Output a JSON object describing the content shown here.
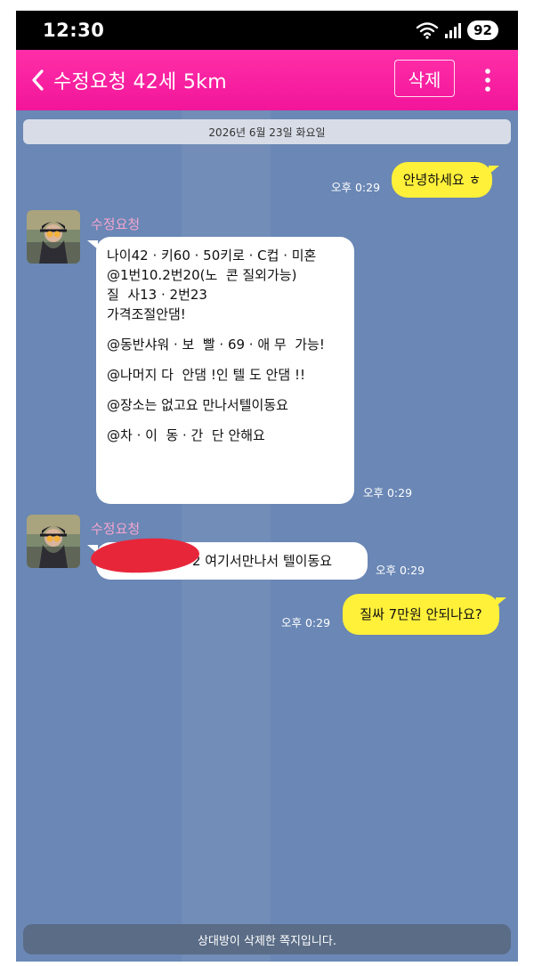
{
  "status_bar": {
    "time": "12:30",
    "battery": "92",
    "wifi_icon": "wifi-icon",
    "signal_icon": "signal-icon"
  },
  "header": {
    "title": "수정요청 42세 5km",
    "delete_label": "삭제",
    "back_icon": "chevron-left-icon",
    "more_icon": "more-vertical-icon"
  },
  "date": "2026년 6월 23일 화요일",
  "messages": [
    {
      "from": "me",
      "text": "안녕하세요 ㅎ",
      "time": "오후 0:29"
    },
    {
      "from": "them",
      "sender": "수정요청",
      "lines": [
        "나이42 · 키60 · 50키로 · C컵 · 미혼",
        "@1번10.2번20(노  콘 질외가능)",
        "질  사13 · 2번23",
        "가격조절안댐!",
        "",
        "@동반샤워 · 보  빨 · 69 · 애 무  가능!",
        "",
        "@나머지 다  안댐 !인 텔 도 안댐 !!",
        "",
        "@장소는 없고요 만나서텔이동요",
        "",
        "@차 · 이  동 · 간  단 안해요"
      ],
      "time": "오후 0:29"
    },
    {
      "from": "them",
      "sender": "수정요청",
      "visible_text": "2  여기서만나서 텔이동요",
      "time": "오후 0:29"
    },
    {
      "from": "me",
      "text": "질싸 7만원 안되나요?",
      "time": "오후 0:29"
    }
  ],
  "footer_notice": "상대방이 삭제한 쪽지입니다.",
  "colors": {
    "header": "#f2159a",
    "chat_background": "#6a87b5",
    "my_bubble": "#fff03a",
    "their_bubble": "#ffffff",
    "sender_name": "#f6a5cf"
  }
}
